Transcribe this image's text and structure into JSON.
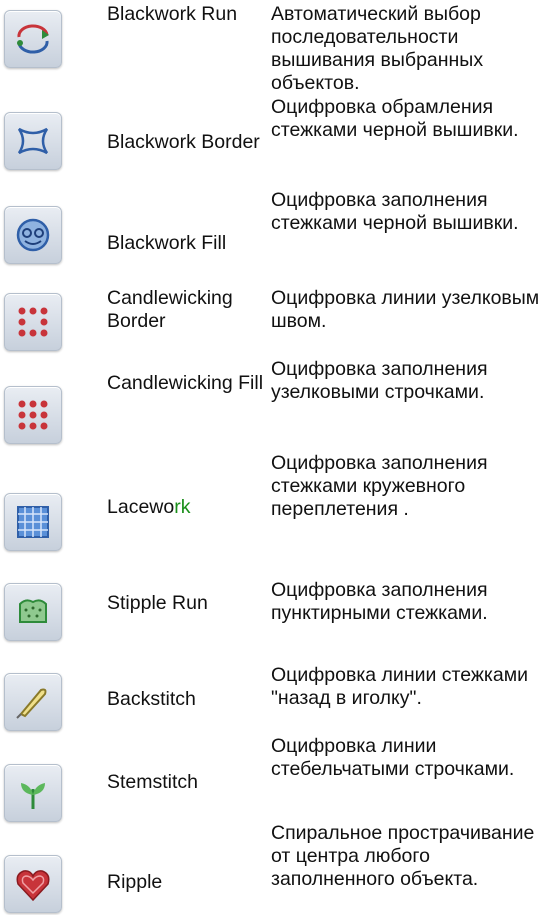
{
  "rows": [
    {
      "icon": "blackwork-run-icon",
      "name": "Blackwork Run",
      "description": "Автоматический выбор последовательности вышивания выбранных объектов."
    },
    {
      "icon": "blackwork-border-icon",
      "name": "Blackwork Border",
      "description": "Оцифровка обрамления стежками черной вышивки."
    },
    {
      "icon": "blackwork-fill-icon",
      "name": "Blackwork Fill",
      "description": "Оцифровка заполнения стежками черной вышивки."
    },
    {
      "icon": "candlewicking-border-icon",
      "name": "Candlewicking Border",
      "description": "Оцифровка линии узелковым швом."
    },
    {
      "icon": "candlewicking-fill-icon",
      "name": "Candlewicking Fill",
      "description": "Оцифровка заполнения узелковыми строчками."
    },
    {
      "icon": "lacework-icon",
      "name_prefix": "Lacewo",
      "name_suffix": "rk",
      "description": "Оцифровка заполнения стежками кружевного переплетения ."
    },
    {
      "icon": "stipple-run-icon",
      "name": "Stipple Run",
      "description": "Оцифровка заполнения пунктирными стежками."
    },
    {
      "icon": "backstitch-icon",
      "name": "Backstitch",
      "description": "Оцифровка линии стежками \"назад в иголку\"."
    },
    {
      "icon": "stemstitch-icon",
      "name": "Stemstitch",
      "description": "Оцифровка линии стебельчатыми строчками."
    },
    {
      "icon": "ripple-icon",
      "name": "Ripple",
      "description": "Спиральное прострачивание от центра любого заполненного объекта."
    }
  ],
  "colors": {
    "name_highlight": "#1a8f1a",
    "icon_red": "#c8343a",
    "icon_blue": "#2f5fa8",
    "icon_green": "#2e8b3a"
  }
}
